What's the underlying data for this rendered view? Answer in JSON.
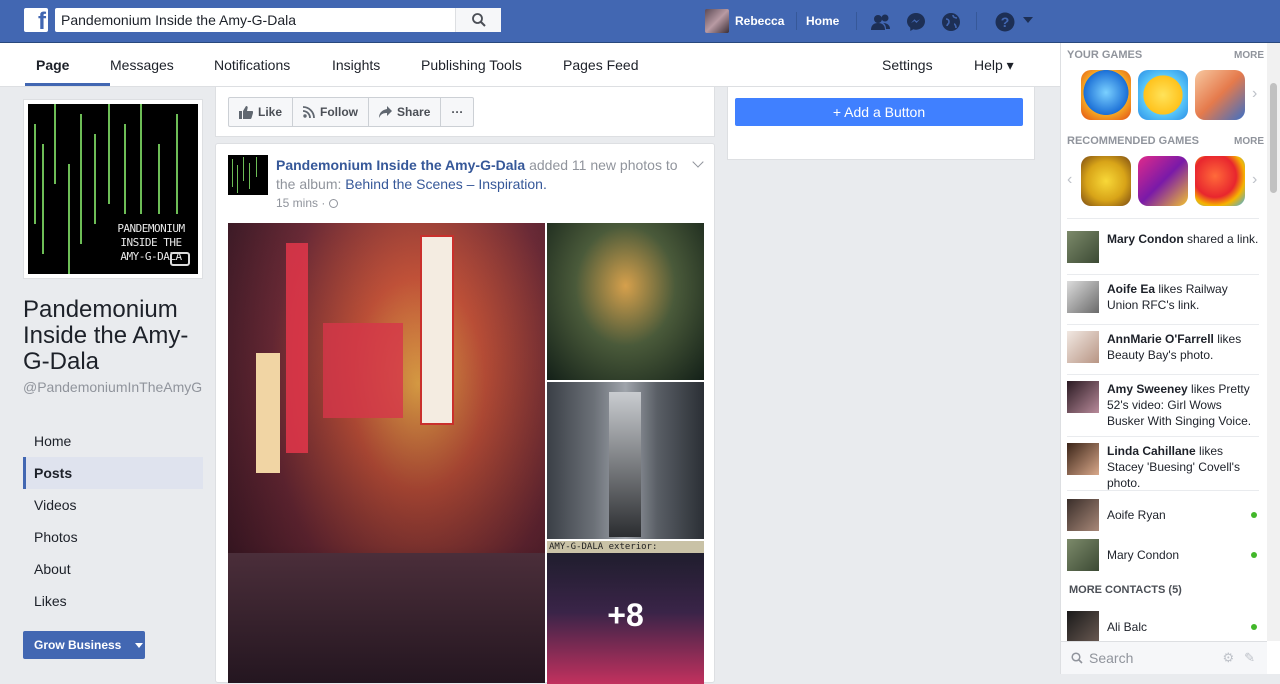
{
  "topbar": {
    "logo": "f",
    "search_value": "Pandemonium Inside the Amy-G-Dala",
    "user_name": "Rebecca",
    "home_label": "Home",
    "icons": [
      "friend-requests-icon",
      "messages-icon",
      "notifications-globe-icon",
      "help-icon",
      "account-menu-caret-icon"
    ],
    "brand_color": "#4267b2"
  },
  "page_nav": {
    "tabs": [
      "Page",
      "Messages",
      "Notifications",
      "Insights",
      "Publishing Tools",
      "Pages Feed"
    ],
    "active": "Page",
    "settings_label": "Settings",
    "help_label": "Help ▾"
  },
  "left": {
    "cover_text": [
      "PANDEMONIUM",
      "INSIDE THE",
      "AMY-G-DALA"
    ],
    "page_name": "Pandemonium Inside the Amy-G-Dala",
    "handle": "@PandemoniumInTheAmyG",
    "nav": [
      "Home",
      "Posts",
      "Videos",
      "Photos",
      "About",
      "Likes"
    ],
    "active_nav": "Posts",
    "grow_label": "Grow Business"
  },
  "actions": {
    "like": "Like",
    "follow": "Follow",
    "share": "Share",
    "more": "···",
    "add_button": "+ Add a Button"
  },
  "post": {
    "author": "Pandemonium Inside the Amy-G-Dala",
    "verb": "added 11 new photos to the album:",
    "album": "Behind the Scenes – Inspiration.",
    "time": "15 mins ·",
    "strip_text": "AMY-G-DALA exterior:",
    "more_count": "+8"
  },
  "right": {
    "your_games": "YOUR GAMES",
    "recommended_games": "RECOMMENDED GAMES",
    "more": "MORE",
    "ticker": [
      {
        "name": "Mary Condon",
        "rest": " shared a link."
      },
      {
        "name": "Aoife Ea",
        "rest": " likes Railway Union RFC's link."
      },
      {
        "name": "AnnMarie O'Farrell",
        "rest": " likes Beauty Bay's photo."
      },
      {
        "name": "Amy Sweeney",
        "rest": " likes Pretty 52's video: Girl Wows Busker With Singing Voice."
      },
      {
        "name": "Linda Cahillane",
        "rest": " likes Stacey 'Buesing' Covell's photo."
      }
    ],
    "contacts": [
      "Aoife Ryan",
      "Mary Condon"
    ],
    "more_contacts": "MORE CONTACTS (5)",
    "more_contacts_list": [
      "Ali Balc"
    ],
    "chat_search": "Search"
  }
}
